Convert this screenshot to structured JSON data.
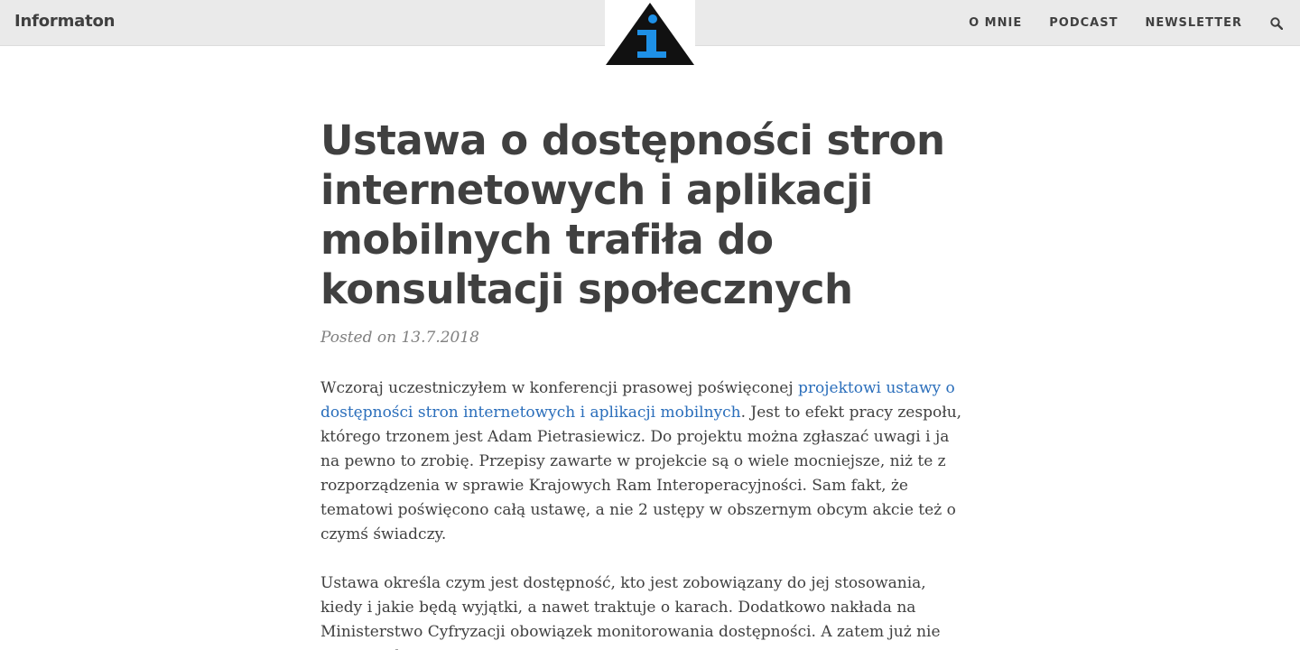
{
  "navbar": {
    "brand": "Informaton",
    "links": [
      "O MNIE",
      "PODCAST",
      "NEWSLETTER"
    ],
    "search_icon": "search-icon"
  },
  "logo": {
    "icon": "info-triangle-logo",
    "colors": {
      "triangle": "#111111",
      "letter": "#1e90e6"
    }
  },
  "post": {
    "title": "Ustawa o dostępności stron internetowych i aplikacji mobilnych trafiła do konsultacji społecznych",
    "meta": "Posted on 13.7.2018",
    "paragraphs": [
      {
        "before": "Wczoraj uczestniczyłem w konferencji prasowej poświęconej ",
        "link": "projektowi ustawy o dostępności stron internetowych i aplikacji mobilnych",
        "after": ". Jest to efekt pracy zespołu, którego trzonem jest Adam Pietrasiewicz. Do projektu można zgłaszać uwagi i ja na pewno to zrobię. Przepisy zawarte w projekcie są o wiele mocniejsze, niż te z rozporządzenia w sprawie Krajowych Ram Interoperacyjności. Sam fakt, że tematowi poświęcono całą ustawę, a nie 2 ustępy w obszernym obcym akcie też o czymś świadczy."
      },
      {
        "text": "Ustawa określa czym jest dostępność, kto jest zobowiązany do jej stosowania, kiedy i jakie będą wyjątki, a nawet traktuje o karach. Dodatkowo nakłada na Ministerstwo Cyfryzacji obowiązek monitorowania dostępności. A zatem już nie partyzantka"
      }
    ]
  },
  "colors": {
    "navbar_bg": "#eaeaea",
    "text": "#404040",
    "meta": "#808080",
    "link": "#2a6ebb"
  }
}
